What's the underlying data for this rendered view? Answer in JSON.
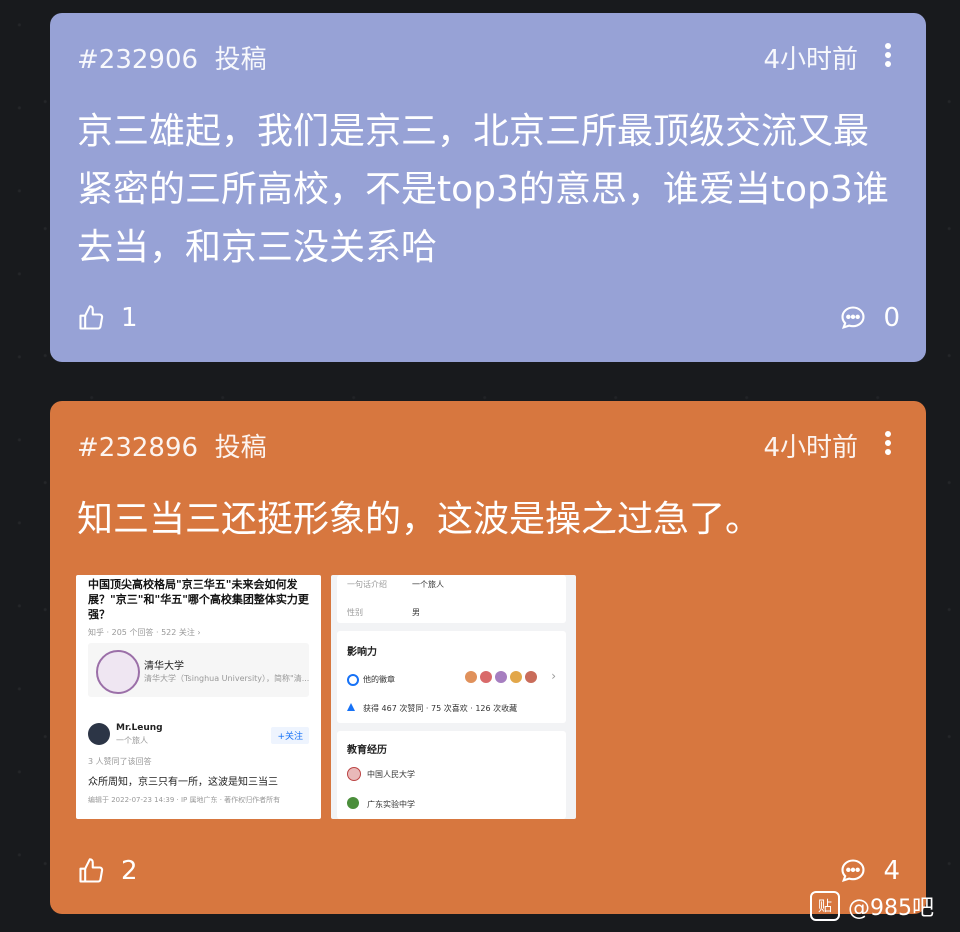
{
  "posts": [
    {
      "id": "#232906",
      "type": "投稿",
      "time": "4小时前",
      "text": "京三雄起，我们是京三，北京三所最顶级交流又最紧密的三所高校，不是top3的意思，谁爱当top3谁去当，和京三没关系哈",
      "likes": "1",
      "comments": "0"
    },
    {
      "id": "#232896",
      "type": "投稿",
      "time": "4小时前",
      "text": "知三当三还挺形象的，这波是操之过急了。",
      "likes": "2",
      "comments": "4",
      "images": {
        "img1": {
          "question": "中国顶尖高校格局\"京三华五\"未来会如何发展？\"京三\"和\"华五\"哪个高校集团整体实力更强？",
          "meta": "知乎 · 205 个回答 · 522 关注 ›",
          "org_name": "清华大学",
          "org_desc": "清华大学（Tsinghua University），简称\"清...",
          "user": "Mr.Leung",
          "user_sub": "一个旅人",
          "follow": "+关注",
          "agree": "3 人赞同了该回答",
          "answer": "众所周知，京三只有一所，这波是知三当三",
          "footer": "编辑于 2022-07-23 14:39 · IP 属地广东 · 著作权归作者所有"
        },
        "img2": {
          "intro_label": "一句话介绍",
          "intro_value": "一个旅人",
          "gender_label": "性别",
          "gender_value": "男",
          "influence_title": "影响力",
          "badges_label": "他的徽章",
          "stats": "获得 467 次赞同 · 75 次喜欢 · 126 次收藏",
          "edu_title": "教育经历",
          "school1": "中国人民大学",
          "school2": "广东实验中学"
        }
      }
    }
  ],
  "watermark": {
    "icon": "贴",
    "text": "@985吧"
  },
  "colors": {
    "card1": "#97a2d6",
    "card2": "#d7773f"
  }
}
